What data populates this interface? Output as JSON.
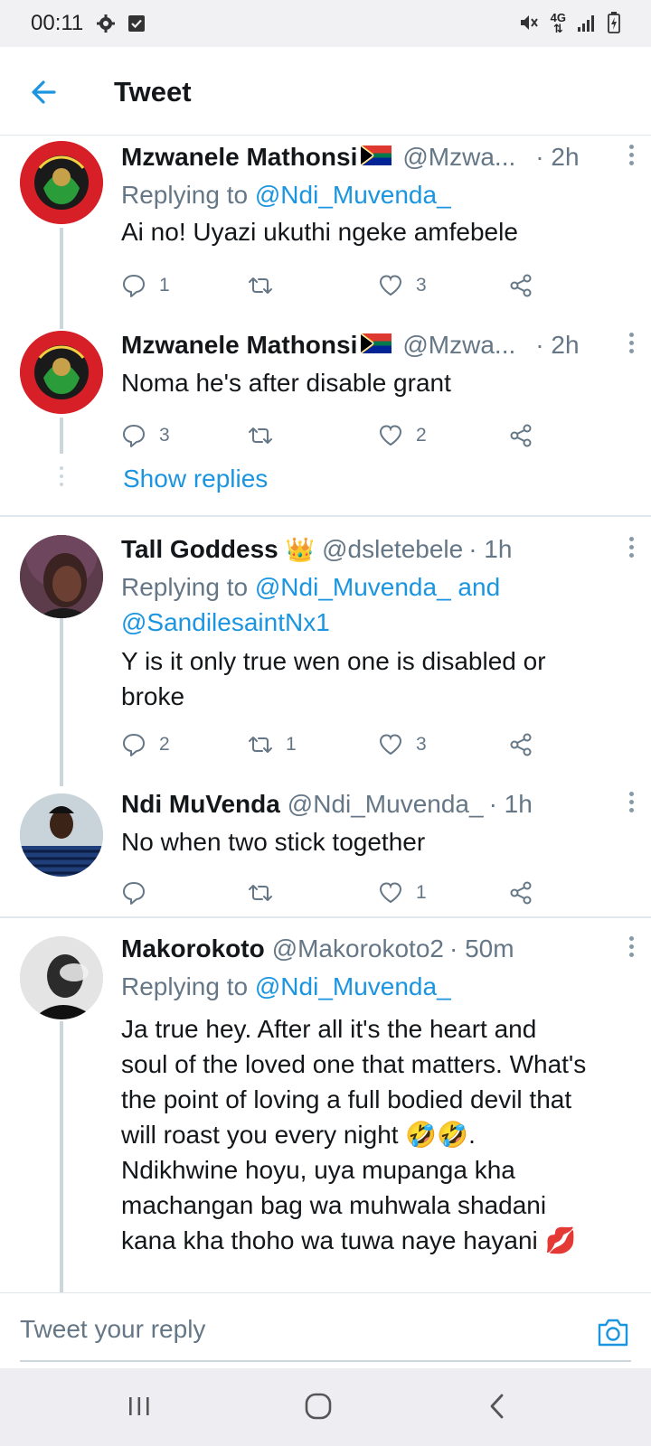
{
  "status_bar": {
    "time": "00:11",
    "icons": [
      "gear-icon",
      "checkbox-icon",
      "mute-icon",
      "4g-icon",
      "signal-icon",
      "battery-icon"
    ],
    "network": "4G"
  },
  "header": {
    "title": "Tweet",
    "back_icon": "arrow-left-icon"
  },
  "colors": {
    "accent": "#1b95e0",
    "muted": "#657786",
    "text": "#14171a",
    "divider": "#e1e8ed"
  },
  "tweets": [
    {
      "name": "Mzwanele Mathonsi",
      "handle": "@Mzwa...",
      "time": "· 2h",
      "replying_prefix": "Replying to ",
      "replying_to": "@Ndi_Muvenda_",
      "text": "Ai no! Uyazi ukuthi ngeke amfebele",
      "replies": "1",
      "retweets": "",
      "likes": "3"
    },
    {
      "name": "Mzwanele Mathonsi",
      "handle": "@Mzwa...",
      "time": "· 2h",
      "text": "Noma he's after disable grant",
      "replies": "3",
      "retweets": "",
      "likes": "2"
    },
    {
      "name": "Tall Goddess",
      "handle": "@dsletebele",
      "time": "· 1h",
      "replying_prefix": "Replying to ",
      "replying_to": "@Ndi_Muvenda_ and",
      "replying_to_2": "@SandilesaintNx1",
      "text_1": "Y is it only true wen one is disabled or",
      "text_2": "broke",
      "replies": "2",
      "retweets": "1",
      "likes": "3"
    },
    {
      "name": "Ndi MuVenda",
      "handle": "@Ndi_Muvenda_",
      "time": "· 1h",
      "text": "No when two stick together",
      "replies": "",
      "retweets": "",
      "likes": "1"
    },
    {
      "name": "Makorokoto",
      "handle": "@Makorokoto2",
      "time": "· 50m",
      "replying_prefix": "Replying to ",
      "replying_to": "@Ndi_Muvenda_",
      "lines": [
        "Ja true hey.  After all it's the heart and",
        "soul of the loved one that matters. What's",
        "the point of loving a full bodied devil that",
        "will roast you every night 🤣🤣.",
        "Ndikhwine hoyu, uya mupanga kha",
        "machangan bag wa muhwala shadani",
        "kana kha thoho wa tuwa naye hayani 💋"
      ]
    }
  ],
  "show_replies": "Show replies",
  "reply_bar": {
    "placeholder": "Tweet your reply",
    "camera_icon": "camera-icon"
  },
  "nav_bar": {
    "icons": [
      "recents-icon",
      "home-icon",
      "back-icon"
    ]
  }
}
